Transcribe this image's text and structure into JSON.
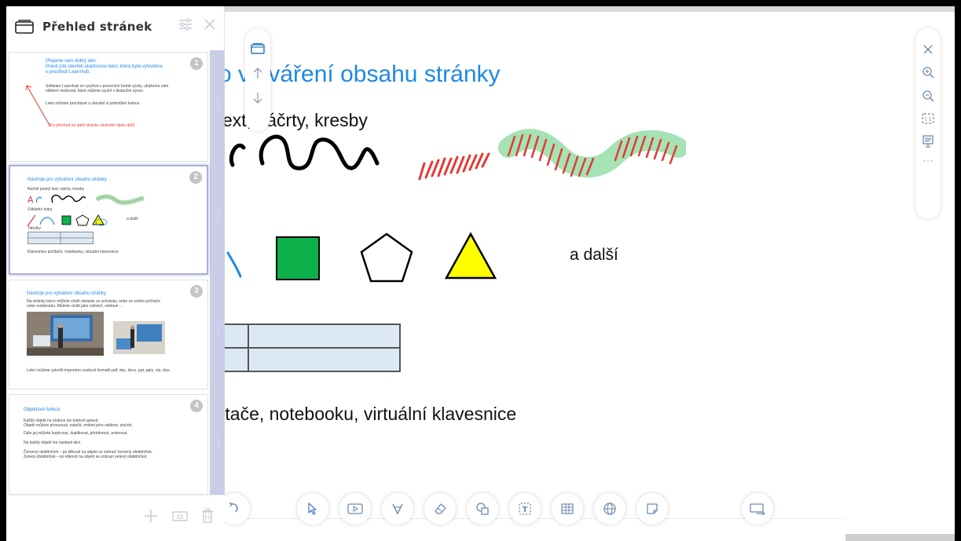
{
  "panel": {
    "title": "Přehled stránek"
  },
  "slide": {
    "title": "o vytváření obsahu stránky",
    "subtitle_text": "ext, náčrty, kresby",
    "more_label": "a další",
    "subtitle_keyboard": "ítače, notebooku, virtuální klavesnice"
  },
  "thumbnails": [
    {
      "number": "1",
      "title": "Přejeme vám dobrý den.\nPrávě jste otevřeli ukázkovou lekci, která byla vytvořena\nv prostředí Learnhub.",
      "lines": [
        "Software Learnhub se využívá v prezenční formě výuky, ukážeme vám",
        "některé možnosti, které můžete využít v distanční výuce.",
        "Lekci můžete procházet a zkoušet si jednotlivé funkce.",
        "Pro přechod na další stránku stiskněte šipku dolů."
      ]
    },
    {
      "number": "2",
      "title": "Nástroje pro vytváření obsahu stránky",
      "lines": [
        "Ručně psaný text, náčrty, kresby",
        "Základní tvary",
        "a další",
        "Tabulky",
        "Klávesnice počítače, notebooku, virtuální klavesnice"
      ]
    },
    {
      "number": "3",
      "title": "Nástroje pro vytváření obsahu stránky",
      "lines": [
        "Na stránky lekce můžete vložit obrázek ze schránky, nebo ze svého počítače",
        "nebo notebooku. Můžete vložit jako celistvé, vektové ...",
        "Lekci můžete vytvořit importem souborů formátů pdf, doc, docx, ppt, pptx, xls, xlsx."
      ]
    },
    {
      "number": "4",
      "title": "Objektové funkce",
      "lines": [
        "Každý objekt na stránce lze kdykoli upravit.",
        "Objekt můžete přesunout, natočit, změnit jeho velikost, ztučnit.",
        "Dále jej můžete kopírovat, duplikovat, přetáhnout, animovat.",
        "Na každý objekt lze nastavit akci.",
        "Červený obdélníček – po kliknutí na objekt se zobrazí červený obdélníček.",
        "Zelený obdélníček – po kliknutí na objekt se zobrazí zelený obdélníček."
      ]
    }
  ],
  "colors": {
    "accent_blue": "#1e88e5",
    "green_square": "#0db14b",
    "yellow_triangle": "#ffff00",
    "hatch_red": "#e53935",
    "highlight_green": "#a5e2b4",
    "table_fill": "#dce9f5",
    "scrollbar": "#c9cde6"
  },
  "icons": {
    "panel": [
      "pages-icon",
      "settings-sliders-icon",
      "close-icon"
    ],
    "footer": [
      "add-page-icon",
      "page-thumbnail-icon",
      "delete-icon"
    ],
    "nav": [
      "pages-icon",
      "arrow-up-icon",
      "arrow-down-icon"
    ],
    "right": [
      "close-icon",
      "zoom-in-icon",
      "zoom-out-icon",
      "zoom-100-icon",
      "presentation-icon",
      "more-dots-icon"
    ],
    "bottom": [
      "redo-icon",
      "select-pointer-icon",
      "media-icon",
      "pen-icon",
      "eraser-icon",
      "shapes-icon",
      "text-icon",
      "table-icon",
      "web-icon",
      "sticky-note-icon",
      "screen-share-icon"
    ]
  }
}
